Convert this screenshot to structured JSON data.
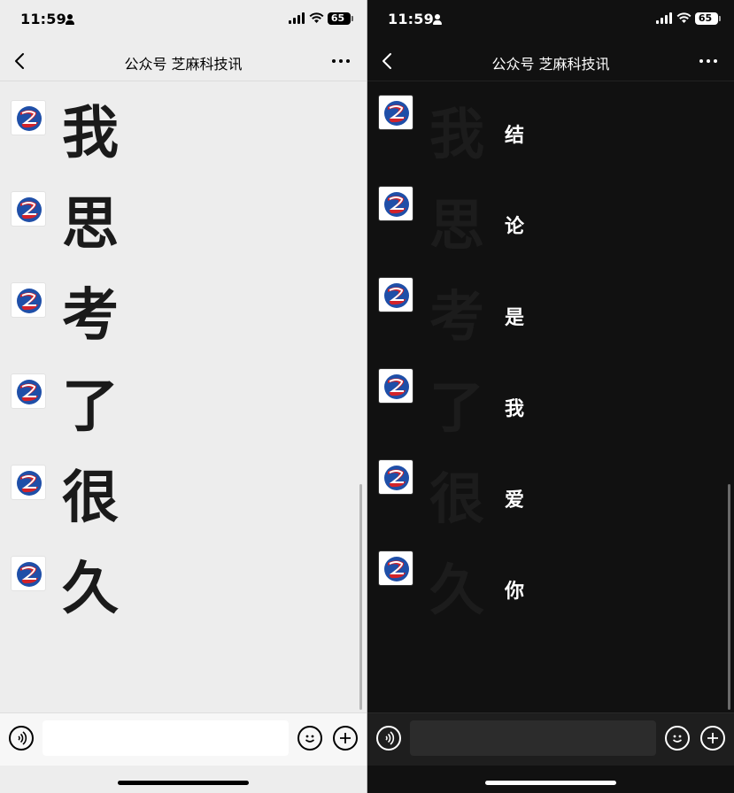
{
  "status_bar": {
    "time": "11:59",
    "battery": "65"
  },
  "header": {
    "title": "公众号 芝麻科技讯"
  },
  "light_panel": {
    "messages": [
      "我",
      "思",
      "考",
      "了",
      "很",
      "久"
    ]
  },
  "dark_panel": {
    "ghost_characters": [
      "我",
      "思",
      "考",
      "了",
      "很",
      "久"
    ],
    "messages": [
      "结",
      "论",
      "是",
      "我",
      "爱",
      "你"
    ]
  },
  "icons": {
    "back": "chevron-left-icon",
    "more": "more-dots-icon",
    "voice": "voice-icon",
    "emoji": "emoji-icon",
    "plus": "plus-icon",
    "avatar": "brand-logo-icon"
  },
  "colors": {
    "light_bg": "#ededed",
    "dark_bg": "#111111",
    "logo_blue": "#1f4fa8",
    "logo_red": "#d2232a"
  }
}
